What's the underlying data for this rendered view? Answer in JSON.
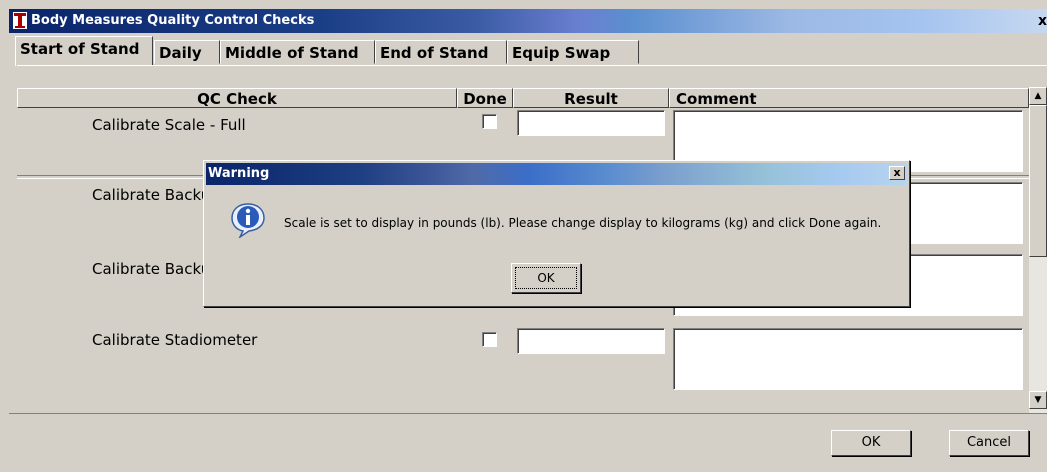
{
  "window": {
    "title": "Body Measures Quality Control Checks",
    "close_glyph": "x"
  },
  "tabs": [
    {
      "label": "Start of Stand",
      "active": true
    },
    {
      "label": "Daily",
      "active": false
    },
    {
      "label": "Middle of Stand",
      "active": false
    },
    {
      "label": "End of Stand",
      "active": false
    },
    {
      "label": "Equip Swap",
      "active": false
    }
  ],
  "table": {
    "headers": [
      "QC Check",
      "Done",
      "Result",
      "Comment"
    ],
    "rows": [
      {
        "label": "Calibrate Scale - Full",
        "done": false,
        "result": "",
        "comment": ""
      },
      {
        "label": "Calibrate Backu",
        "done": false,
        "result": "",
        "comment": ""
      },
      {
        "label": "Calibrate Backu",
        "done": false,
        "result": "",
        "comment": ""
      },
      {
        "label": "Calibrate Stadiometer",
        "done": false,
        "result": "",
        "comment": ""
      }
    ]
  },
  "footer": {
    "ok_label": "OK",
    "cancel_label": "Cancel"
  },
  "dialog": {
    "title": "Warning",
    "close_glyph": "x",
    "icon": "info-icon",
    "message": "Scale is set to display in pounds (lb).  Please change display to kilograms (kg) and click Done again.",
    "ok_label": "OK"
  },
  "colors": {
    "face": "#d4d0c8",
    "title_start": "#0a246a",
    "title_end": "#a6c4f0"
  }
}
